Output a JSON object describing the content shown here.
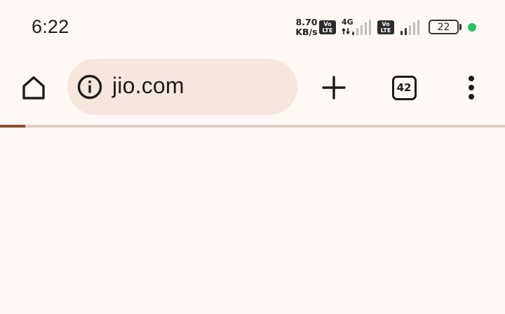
{
  "status_bar": {
    "time": "6:22",
    "net_speed_value": "8.70",
    "net_speed_unit": "KB/s",
    "volte_top": "Vo",
    "volte_bottom": "LTE",
    "network_type": "4G",
    "battery_level": "22",
    "privacy_dot_color": "#22c55e"
  },
  "toolbar": {
    "url": "jio.com",
    "tab_count": "42",
    "omnibox_color": "#f6e6de"
  },
  "page_load": {
    "progress": 0.05,
    "accent_color": "#8a4f2c"
  },
  "icons": {
    "home": "home-icon",
    "info": "info-icon",
    "new_tab": "plus-icon",
    "tabs": "tab-switcher-icon",
    "menu": "more-vertical-icon"
  }
}
